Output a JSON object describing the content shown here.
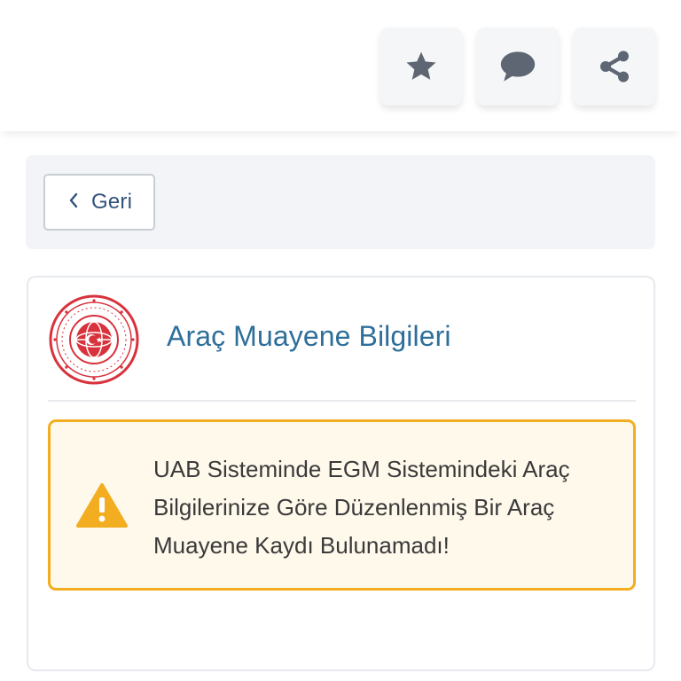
{
  "toolbar": {
    "favorite_icon": "star-icon",
    "comment_icon": "comment-icon",
    "share_icon": "share-icon"
  },
  "nav": {
    "back_label": "Geri",
    "back_icon": "chevron-left-icon"
  },
  "card": {
    "title": "Araç Muayene Bilgileri",
    "logo": "ministry-seal-logo",
    "alert": {
      "icon": "warning-icon",
      "message": "UAB Sisteminde EGM Sistemindeki Araç Bilgilerinize Göre Düzenlenmiş Bir Araç Muayene Kaydı Bulunamadı!"
    }
  },
  "colors": {
    "title": "#2e6f9a",
    "back_text": "#33527a",
    "icon_gray": "#5e6673",
    "warning": "#f2ae20",
    "alert_bg": "#fff9ec",
    "seal_red": "#d8333d"
  }
}
